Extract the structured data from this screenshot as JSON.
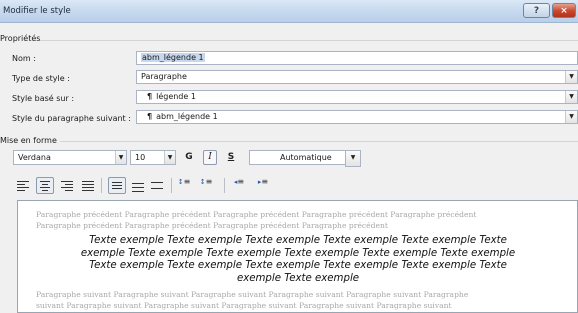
{
  "window": {
    "title": "Modifier le style",
    "help_label": "?",
    "close_label": "×"
  },
  "properties": {
    "section_label": "Propriétés",
    "name_label": "Nom :",
    "name_value": "abm_légende 1",
    "type_label": "Type de style :",
    "type_value": "Paragraphe",
    "based_on_label": "Style basé sur :",
    "based_on_value": "légende 1",
    "next_style_label": "Style du paragraphe suivant :",
    "next_style_value": "abm_légende 1",
    "paragraph_mark": "¶"
  },
  "formatting": {
    "section_label": "Mise en forme",
    "font": "Verdana",
    "size": "10",
    "bold": "G",
    "italic": "I",
    "underline": "S",
    "color": "Automatique"
  },
  "preview": {
    "previous_para_1": "Paragraphe précédent Paragraphe précédent Paragraphe précédent Paragraphe précédent Paragraphe précédent",
    "previous_para_2": "Paragraphe précédent Paragraphe précédent Paragraphe précédent Paragraphe précédent",
    "sample_line_1": "Texte exemple Texte exemple Texte exemple Texte exemple Texte exemple Texte",
    "sample_line_2": "exemple Texte exemple Texte exemple Texte exemple Texte exemple Texte exemple",
    "sample_line_3": "Texte exemple Texte exemple Texte exemple Texte exemple Texte exemple Texte",
    "sample_line_4": "exemple Texte exemple",
    "following_para_1": "Paragraphe suivant Paragraphe suivant Paragraphe suivant Paragraphe suivant Paragraphe suivant Paragraphe",
    "following_para_2": "suivant Paragraphe suivant Paragraphe suivant Paragraphe suivant Paragraphe suivant Paragraphe suivant"
  }
}
